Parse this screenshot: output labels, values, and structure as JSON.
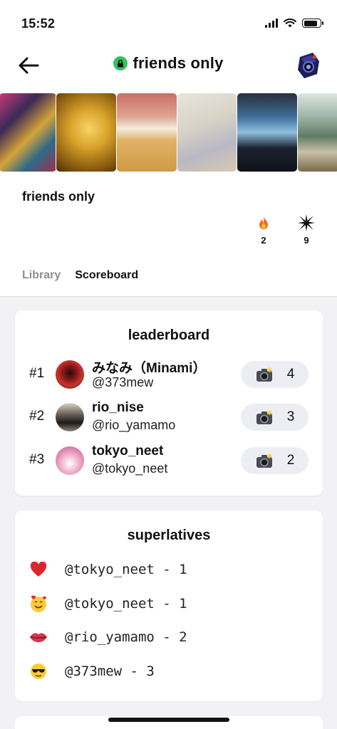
{
  "status_bar": {
    "time": "15:52"
  },
  "header": {
    "title": "friends only"
  },
  "album": {
    "title": "friends only",
    "stats": [
      {
        "icon": "fire-icon",
        "value": "2"
      },
      {
        "icon": "spark-icon",
        "value": "9"
      }
    ]
  },
  "tabs": [
    {
      "label": "Library",
      "active": false
    },
    {
      "label": "Scoreboard",
      "active": true
    }
  ],
  "leaderboard": {
    "title": "leaderboard",
    "rows": [
      {
        "rank": "#1",
        "name": "みなみ（Minami）",
        "handle": "@373mew",
        "count": "4"
      },
      {
        "rank": "#2",
        "name": "rio_nise",
        "handle": "@rio_yamamo",
        "count": "3"
      },
      {
        "rank": "#3",
        "name": "tokyo_neet",
        "handle": "@tokyo_neet",
        "count": "2"
      }
    ]
  },
  "superlatives": {
    "title": "superlatives",
    "rows": [
      {
        "emoji": "heart-icon",
        "text": "@tokyo_neet - 1"
      },
      {
        "emoji": "smiling-hearts-icon",
        "text": "@tokyo_neet - 1"
      },
      {
        "emoji": "lips-icon",
        "text": "@rio_yamamo - 2"
      },
      {
        "emoji": "sunglasses-icon",
        "text": "@373mew - 3"
      }
    ]
  },
  "colors": {
    "lock_badge": "#33c45a",
    "pill_bg": "#ededf4",
    "inactive_tab": "#8e8e93",
    "page_bg": "#f2f2f4"
  }
}
